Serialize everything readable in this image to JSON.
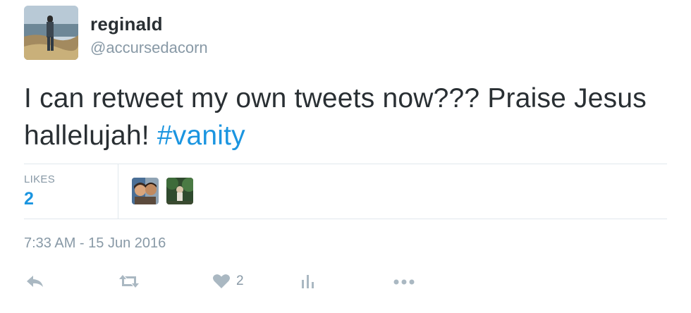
{
  "user": {
    "display_name": "reginald",
    "handle": "@accursedacorn"
  },
  "tweet": {
    "text": "I can retweet my own tweets now??? Praise Jesus hallelujah! ",
    "hashtag": "#vanity",
    "timestamp": "7:33 AM - 15 Jun 2016"
  },
  "stats": {
    "likes_label": "LIKES",
    "likes_count": "2"
  },
  "actions": {
    "reply_icon": "reply-icon",
    "retweet_icon": "retweet-icon",
    "like_icon": "heart-icon",
    "like_count": "2",
    "analytics_icon": "analytics-icon",
    "more_icon": "more-icon"
  },
  "colors": {
    "accent": "#1b95e0",
    "text": "#292f33",
    "muted": "#8899a6",
    "icon": "#aab8c2",
    "divider": "#e1e8ed"
  }
}
